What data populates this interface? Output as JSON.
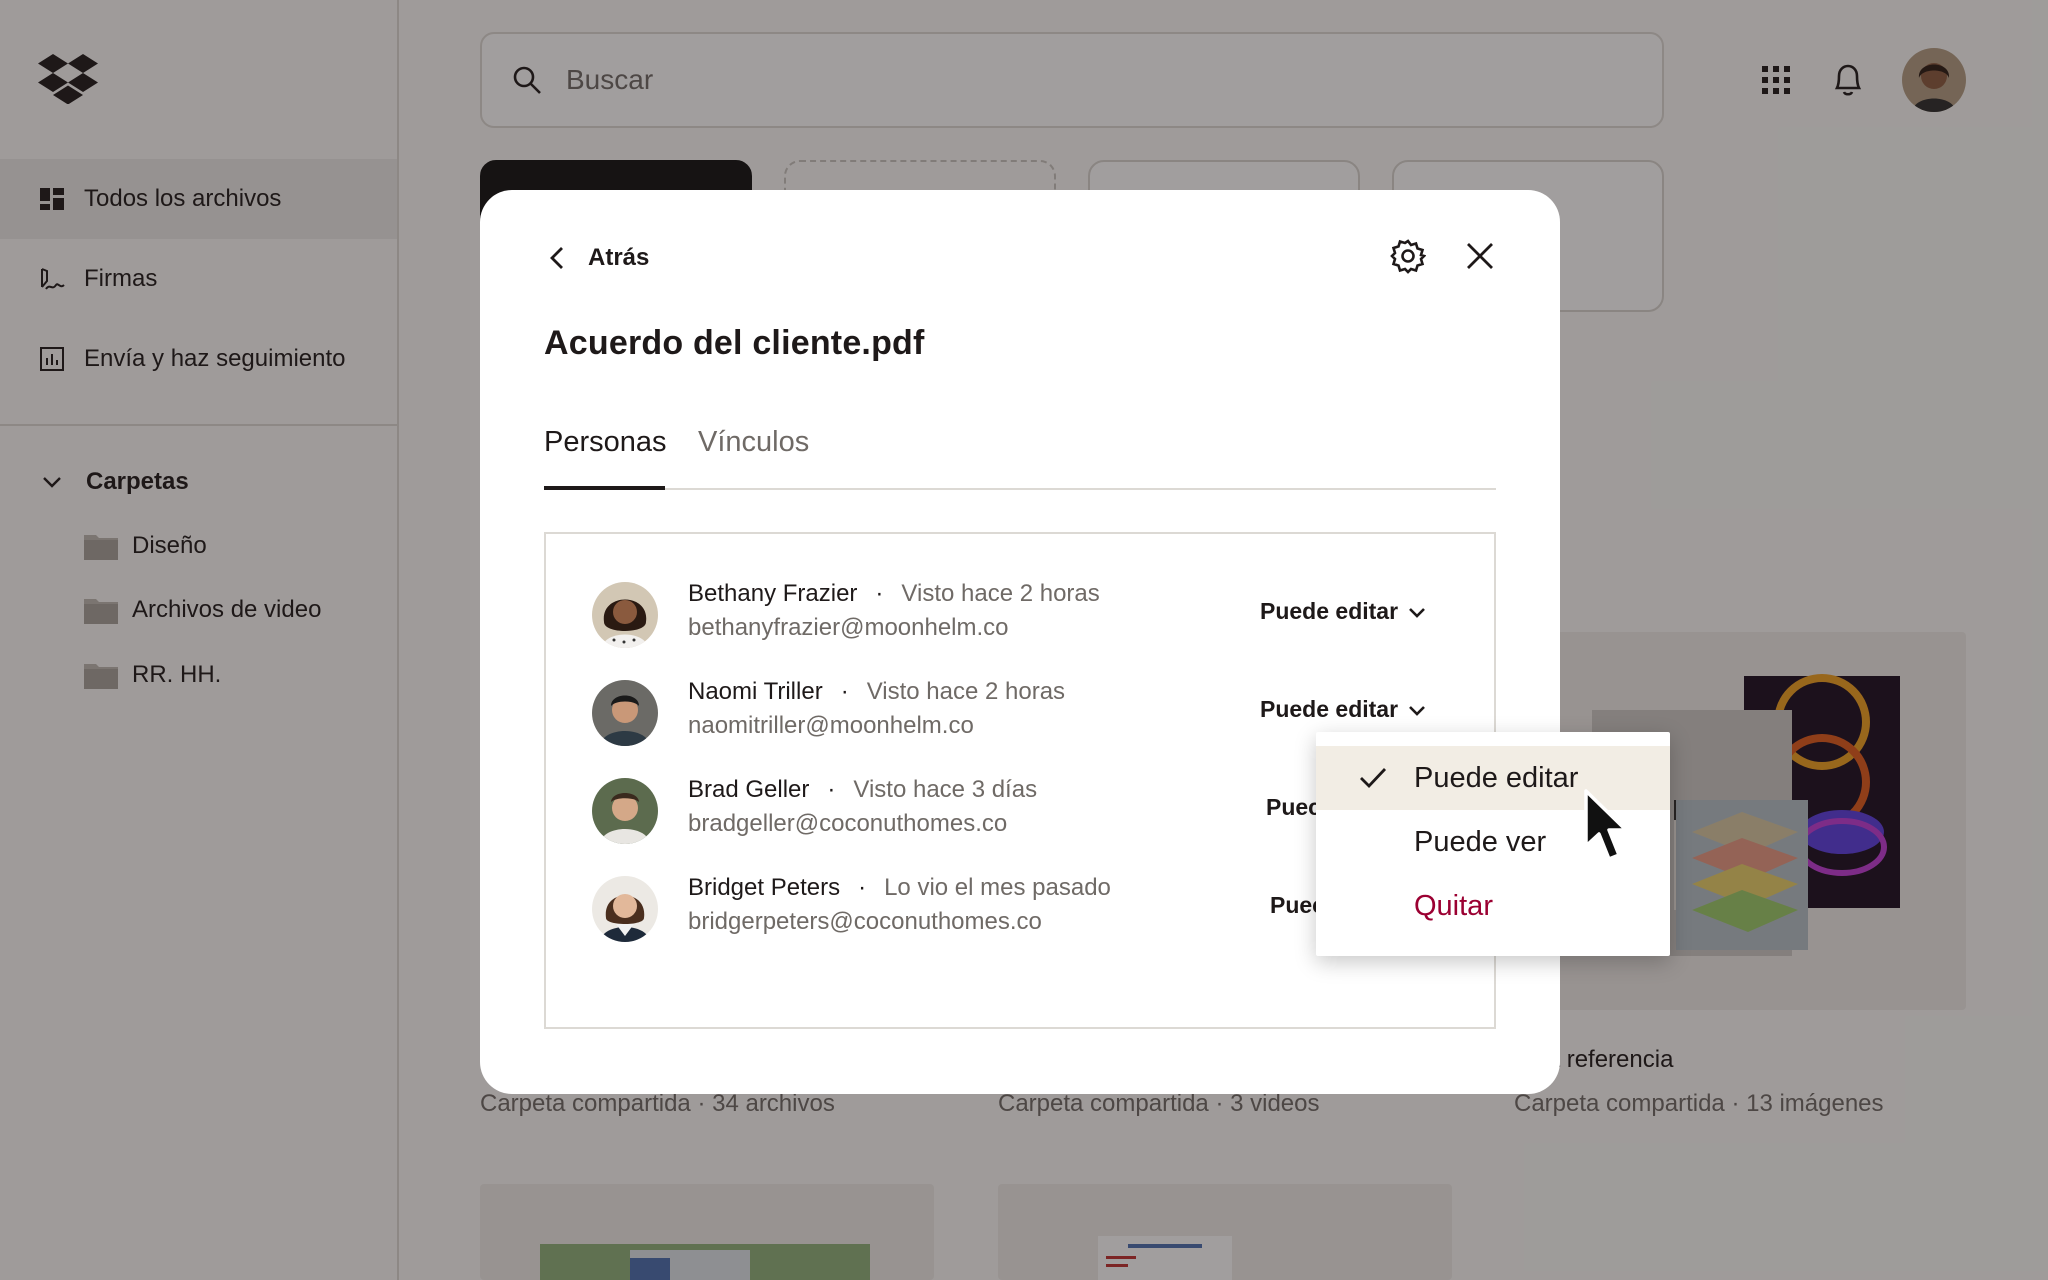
{
  "search": {
    "placeholder": "Buscar"
  },
  "sidebar": {
    "items": [
      {
        "label": "Todos los archivos"
      },
      {
        "label": "Firmas"
      },
      {
        "label": "Envía y haz seguimiento"
      }
    ],
    "folders_heading": "Carpetas",
    "folders": [
      {
        "label": "Diseño"
      },
      {
        "label": "Archivos de video"
      },
      {
        "label": "RR. HH."
      }
    ]
  },
  "cards": [
    {
      "subtitle": "Carpeta compartida · 34 archivos"
    },
    {
      "subtitle": "Carpeta compartida · 3 videos"
    },
    {
      "title": "pera referencia",
      "subtitle": "Carpeta compartida · 13 imágenes"
    }
  ],
  "modal": {
    "back_label": "Atrás",
    "file_title": "Acuerdo del cliente.pdf",
    "tabs": [
      {
        "label": "Personas"
      },
      {
        "label": "Vínculos"
      }
    ],
    "people": [
      {
        "name": "Bethany Frazier",
        "seen": "Visto hace 2 horas",
        "email": "bethanyfrazier@moonhelm.co",
        "permission": "Puede editar"
      },
      {
        "name": "Naomi Triller",
        "seen": "Visto hace 2 horas",
        "email": "naomitriller@moonhelm.co",
        "permission": "Puede editar"
      },
      {
        "name": "Brad Geller",
        "seen": "Visto hace 3 días",
        "email": "bradgeller@coconuthomes.co",
        "permission": "Puec"
      },
      {
        "name": "Bridget Peters",
        "seen": "Lo vio el mes pasado",
        "email": "bridgerpeters@coconuthomes.co",
        "permission": "Puec"
      }
    ],
    "dot": "·"
  },
  "dropdown": {
    "options": [
      {
        "label": "Puede editar",
        "selected": true
      },
      {
        "label": "Puede ver"
      },
      {
        "label": "Quitar",
        "color": "#9b0032"
      }
    ]
  },
  "colors": {
    "accent_dark": "#1e1919",
    "danger": "#9b0032",
    "selected_bg": "#f2ede4"
  }
}
